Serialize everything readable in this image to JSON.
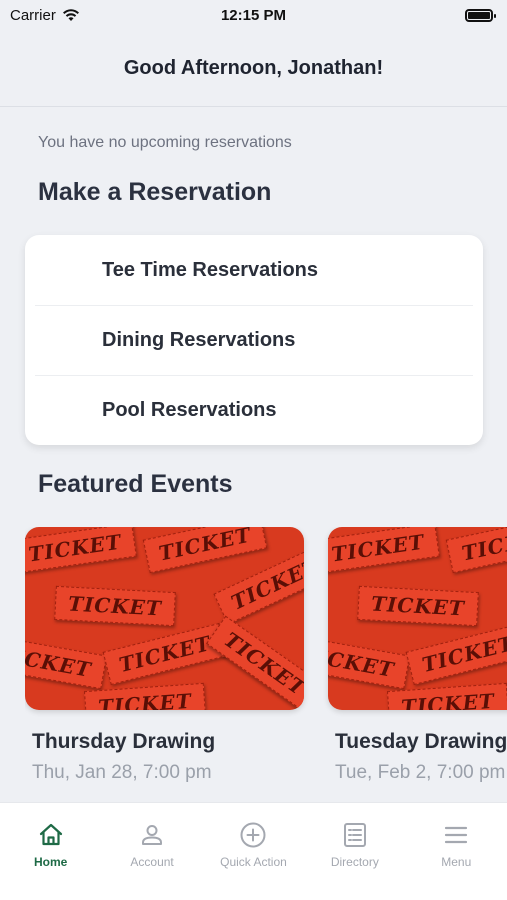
{
  "status_bar": {
    "carrier": "Carrier",
    "time": "12:15 PM"
  },
  "header": {
    "title": "Good Afternoon, Jonathan!"
  },
  "reservations_notice": "You have no upcoming reservations",
  "make_reservation": {
    "title": "Make a Reservation",
    "items": [
      {
        "label": "Tee Time Reservations"
      },
      {
        "label": "Dining Reservations"
      },
      {
        "label": "Pool Reservations"
      }
    ]
  },
  "featured_events": {
    "title": "Featured Events",
    "items": [
      {
        "title": "Thursday Drawing",
        "date": "Thu, Jan 28, 7:00 pm",
        "image_text": "TICKET"
      },
      {
        "title": "Tuesday Drawing",
        "date": "Tue, Feb 2, 7:00 pm",
        "image_text": "TICKET"
      }
    ]
  },
  "tabbar": {
    "items": [
      {
        "label": "Home",
        "icon": "home-icon",
        "active": true
      },
      {
        "label": "Account",
        "icon": "account-icon",
        "active": false
      },
      {
        "label": "Quick Action",
        "icon": "plus-circle-icon",
        "active": false
      },
      {
        "label": "Directory",
        "icon": "directory-icon",
        "active": false
      },
      {
        "label": "Menu",
        "icon": "menu-icon",
        "active": false
      }
    ],
    "active_color": "#1e6a46",
    "inactive_color": "#a4a8b0"
  }
}
